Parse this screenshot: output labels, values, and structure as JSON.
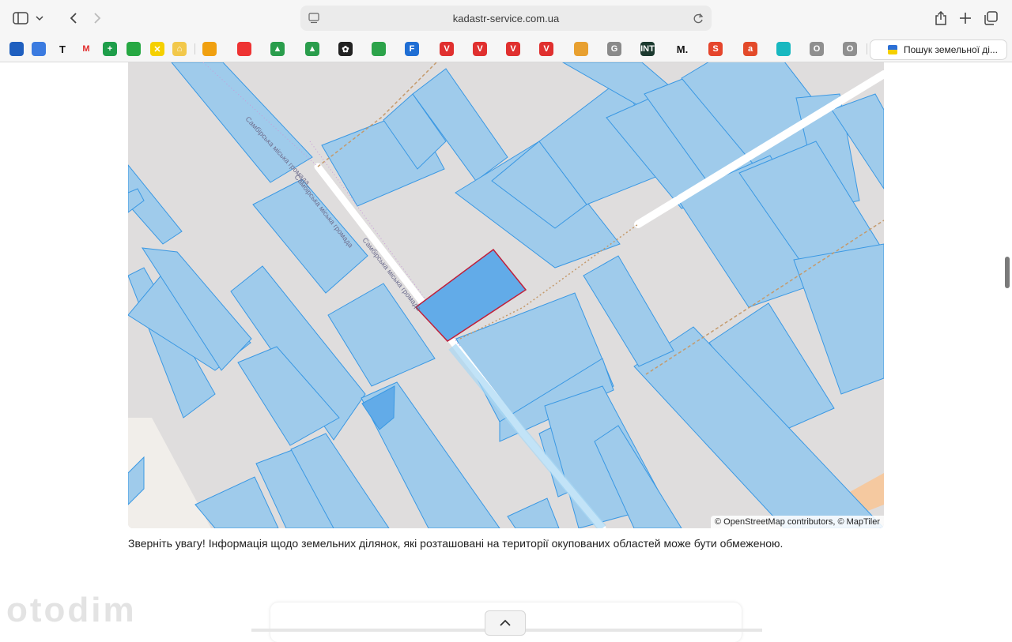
{
  "browser": {
    "url": "kadastr-service.com.ua",
    "tab_title": "Пошук земельної ді...",
    "bookmarks": [
      {
        "icon": "camera-icon",
        "label": "",
        "color": "#1f5fbf"
      },
      {
        "icon": "butterfly-icon",
        "label": "",
        "color": "#3b7be0"
      },
      {
        "icon": "t-icon",
        "label": "T",
        "color": "#111111"
      },
      {
        "icon": "m-icon",
        "label": "M",
        "color": "#e12b2b"
      },
      {
        "icon": "sheets-icon",
        "label": "+",
        "color": "#1e9e4a"
      },
      {
        "icon": "circle-icon",
        "label": "",
        "color": "#27a843"
      },
      {
        "icon": "raiffeisen-icon",
        "label": "✕",
        "color": "#f5d000"
      },
      {
        "icon": "house-icon",
        "label": "⌂",
        "color": "#f2c84b"
      },
      {
        "icon": "sun-icon",
        "label": "",
        "color": "#f0a010"
      },
      {
        "icon": "red-swoosh-icon",
        "label": "",
        "color": "#e33"
      },
      {
        "icon": "drive-icon",
        "label": "▲",
        "color": "#2a9d4c"
      },
      {
        "icon": "drive-icon",
        "label": "▲",
        "color": "#2a9d4c"
      },
      {
        "icon": "openai-icon",
        "label": "✿",
        "color": "#222222"
      },
      {
        "icon": "ring-icon",
        "label": "",
        "color": "#2ca34a"
      },
      {
        "icon": "f-icon",
        "label": "F",
        "color": "#1f6ed4"
      },
      {
        "icon": "v-icon",
        "label": "V",
        "color": "#e0302f"
      },
      {
        "icon": "v-icon",
        "label": "V",
        "color": "#e0302f"
      },
      {
        "icon": "v-icon",
        "label": "V",
        "color": "#e0302f"
      },
      {
        "icon": "v-icon",
        "label": "V",
        "color": "#e0302f"
      },
      {
        "icon": "bag-icon",
        "label": "",
        "color": "#e8a030"
      },
      {
        "icon": "g-icon",
        "label": "G",
        "color": "#8a8a8a"
      },
      {
        "icon": "int-icon",
        "label": "INT",
        "color": "#1c3a2f"
      },
      {
        "icon": "m-icon",
        "label": "M.",
        "color": "#111111"
      },
      {
        "icon": "s-icon",
        "label": "S",
        "color": "#e5452c"
      },
      {
        "icon": "a-icon",
        "label": "a",
        "color": "#e34a2a"
      },
      {
        "icon": "chat-icon",
        "label": "",
        "color": "#18b8c0"
      },
      {
        "icon": "o-icon",
        "label": "O",
        "color": "#8f8f8f"
      },
      {
        "icon": "o-icon",
        "label": "O",
        "color": "#8f8f8f"
      }
    ]
  },
  "map": {
    "street_labels": [
      "Самбірська міська громада",
      "Самбірська міська громада",
      "Самбірська міська громада"
    ],
    "attribution": "© OpenStreetMap contributors, © MapTiler",
    "parcel_color": "#62abe8",
    "selected_outline": "#c0203a"
  },
  "notice": "Зверніть увагу! Інформація щодо земельних ділянок, які розташовані на території окупованих областей може бути обмеженою.",
  "watermark": "otodim"
}
